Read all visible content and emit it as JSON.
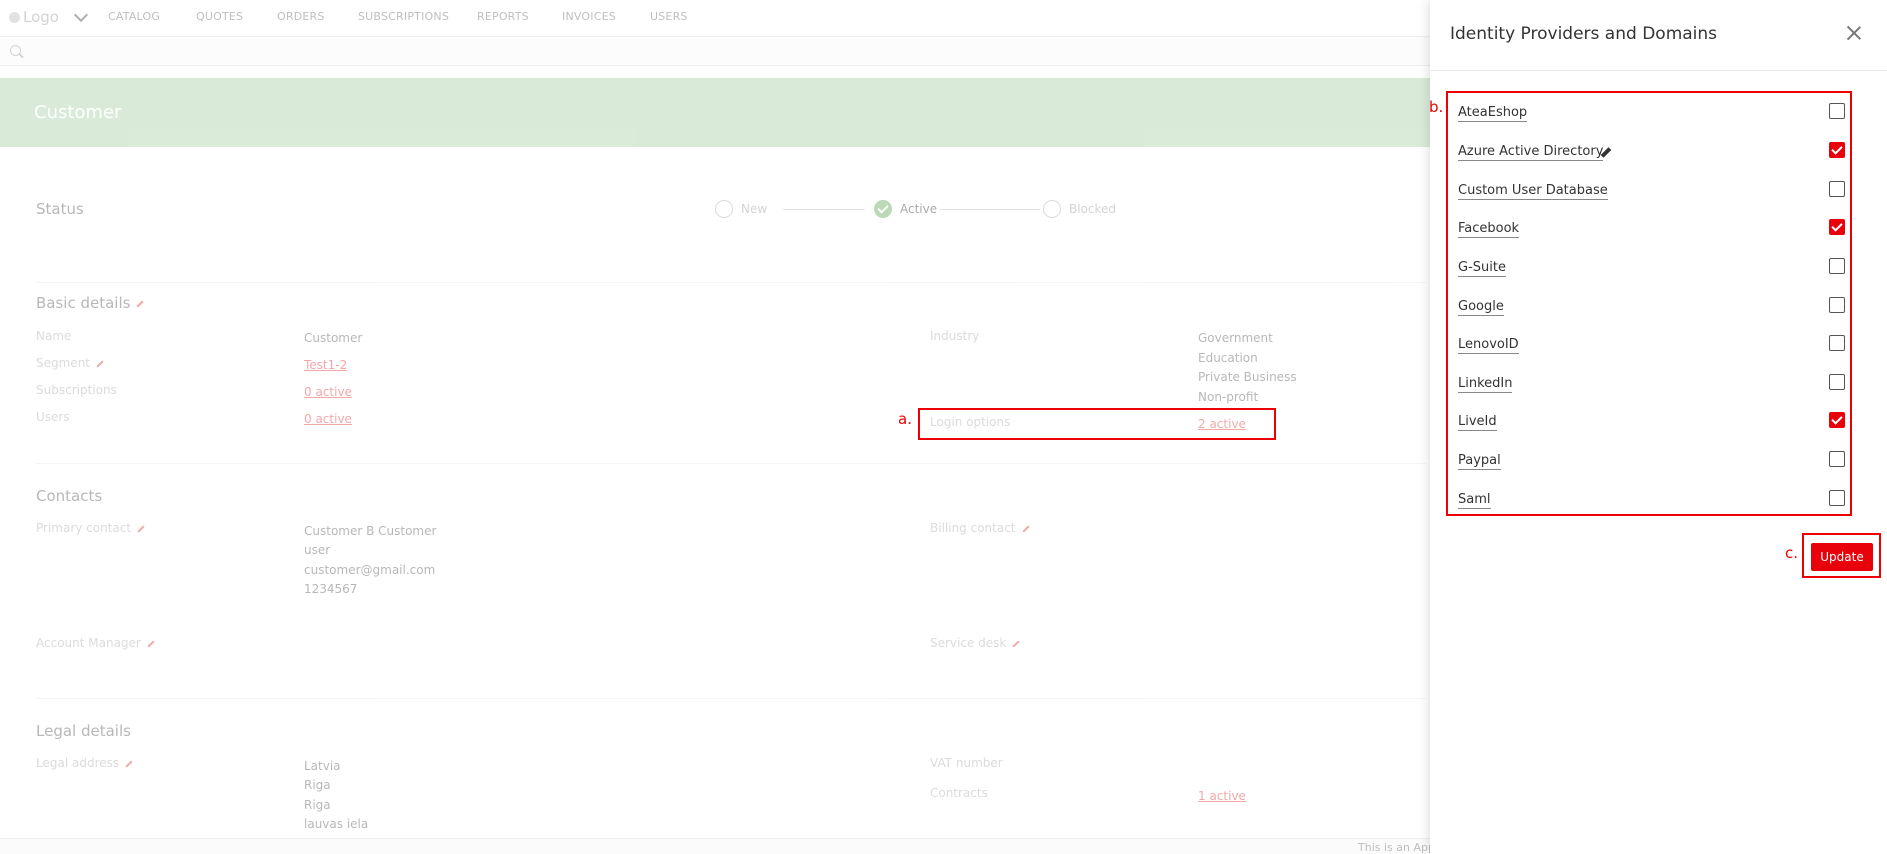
{
  "app": {
    "logo_text": "Logo",
    "nav": [
      "CATALOG",
      "QUOTES",
      "ORDERS",
      "SUBSCRIPTIONS",
      "REPORTS",
      "INVOICES",
      "USERS"
    ],
    "banner_title": "Customer",
    "status": {
      "label": "Status",
      "steps": [
        "New",
        "Active",
        "Blocked"
      ],
      "current": "Active"
    },
    "basic_details": {
      "title": "Basic details",
      "fields": {
        "name_label": "Name",
        "name_value": "Customer",
        "segment_label": "Segment",
        "segment_value": "Test1-2",
        "subscriptions_label": "Subscriptions",
        "subscriptions_value": "0 active",
        "users_label": "Users",
        "users_value": "0 active",
        "industry_label": "Industry",
        "industry_values": [
          "Government",
          "Education",
          "Private Business",
          "Non-profit"
        ],
        "login_options_label": "Login options",
        "login_options_value": "2 active"
      }
    },
    "contacts": {
      "title": "Contacts",
      "primary_contact_label": "Primary contact",
      "primary_contact_lines": [
        "Customer B Customer",
        "user",
        "customer@gmail.com",
        "1234567"
      ],
      "billing_contact_label": "Billing contact",
      "account_manager_label": "Account Manager",
      "service_desk_label": "Service desk"
    },
    "legal_details": {
      "title": "Legal details",
      "legal_address_label": "Legal address",
      "legal_address_lines": [
        "Latvia",
        "Riga",
        "Riga",
        "lauvas iela"
      ],
      "vat_number_label": "VAT number",
      "contracts_label": "Contracts",
      "contracts_value": "1 active"
    },
    "footer_text": "This is an App"
  },
  "annotations": {
    "a": "a.",
    "b": "b.",
    "c": "c."
  },
  "drawer": {
    "title": "Identity Providers and Domains",
    "providers": [
      {
        "name": "AteaEshop",
        "checked": false
      },
      {
        "name": "Azure Active Directory",
        "checked": true,
        "editable": true
      },
      {
        "name": "Custom User Database",
        "checked": false
      },
      {
        "name": "Facebook",
        "checked": true
      },
      {
        "name": "G-Suite",
        "checked": false
      },
      {
        "name": "Google",
        "checked": false
      },
      {
        "name": "LenovoID",
        "checked": false
      },
      {
        "name": "LinkedIn",
        "checked": false
      },
      {
        "name": "LiveId",
        "checked": true
      },
      {
        "name": "Paypal",
        "checked": false
      },
      {
        "name": "Saml",
        "checked": false
      }
    ],
    "update_label": "Update"
  },
  "colors": {
    "accent": "#e8000b",
    "banner": "#a6cfa4",
    "active_step": "#5aa94f"
  }
}
